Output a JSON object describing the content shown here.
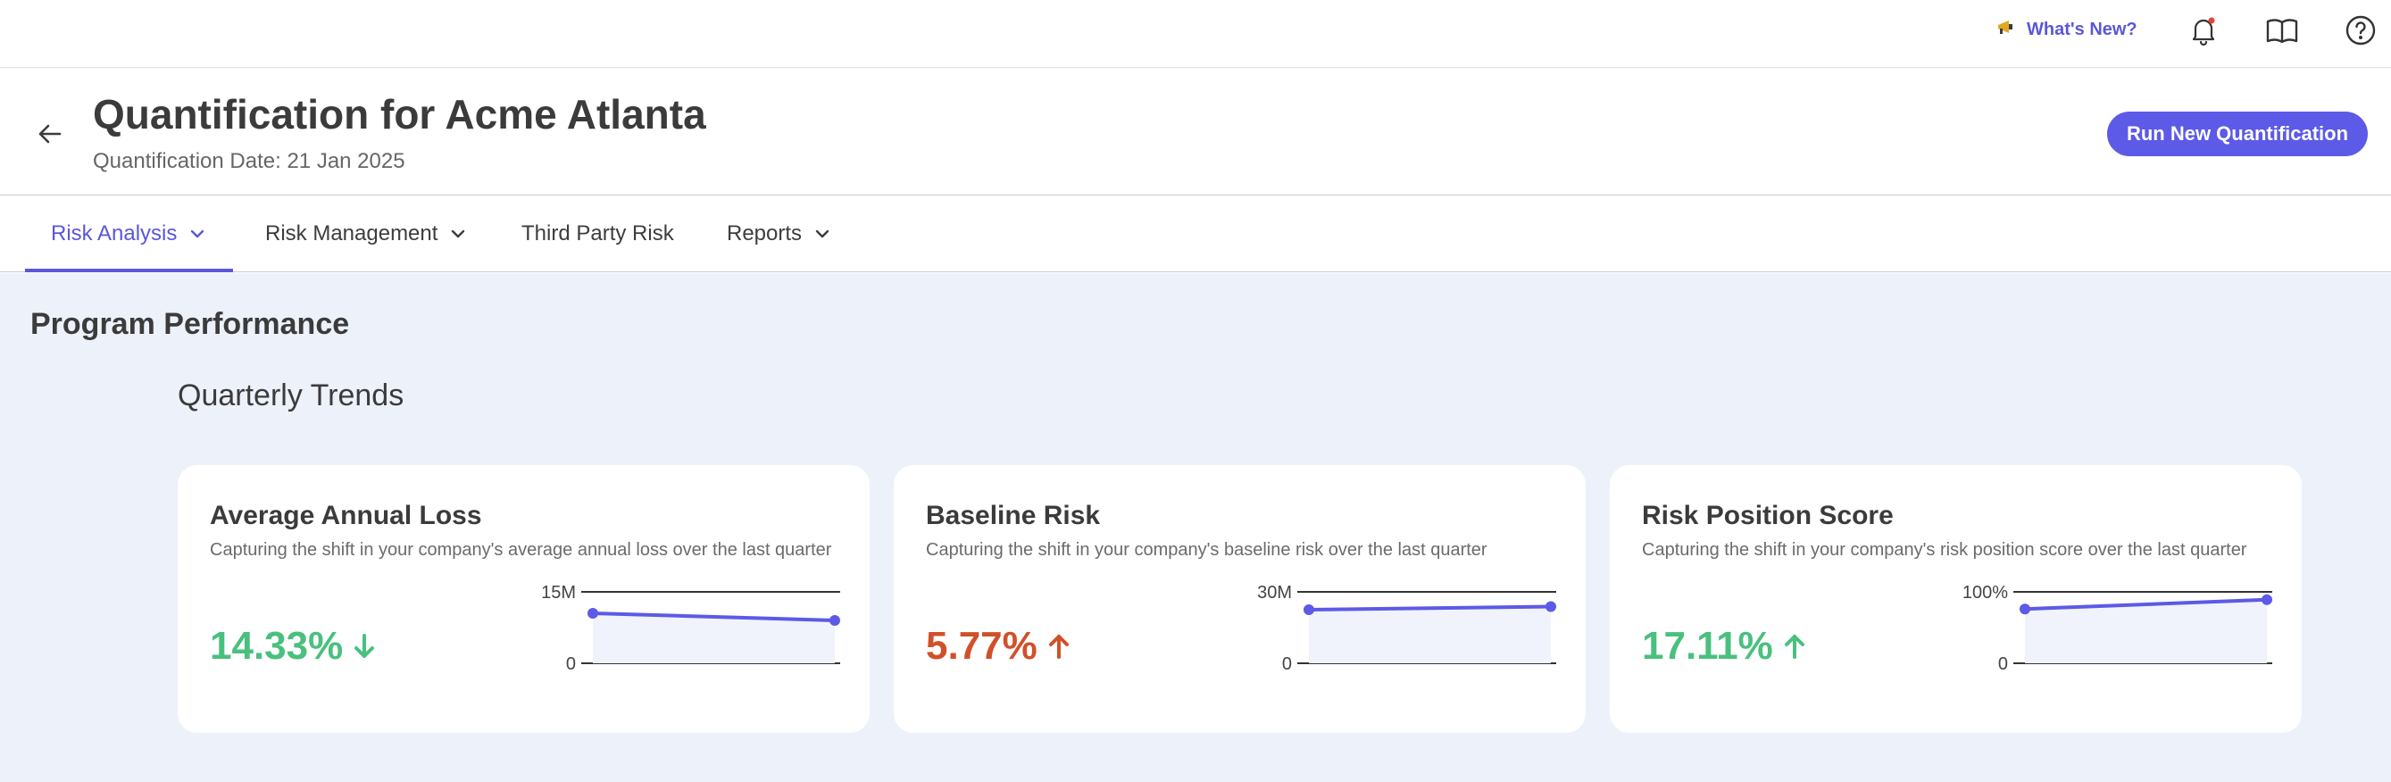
{
  "topbar": {
    "whats_new_label": "What's New?",
    "icons": [
      "notification-bell-icon",
      "book-icon",
      "help-icon"
    ]
  },
  "header": {
    "title": "Quantification for Acme Atlanta",
    "subtitle": "Quantification Date: 21 Jan 2025",
    "run_button": "Run New Quantification"
  },
  "tabs": [
    {
      "label": "Risk Analysis",
      "active": true,
      "has_dropdown": true
    },
    {
      "label": "Risk Management",
      "active": false,
      "has_dropdown": true
    },
    {
      "label": "Third Party Risk",
      "active": false,
      "has_dropdown": false
    },
    {
      "label": "Reports",
      "active": false,
      "has_dropdown": true
    }
  ],
  "main": {
    "section_title": "Program Performance",
    "subsection_title": "Quarterly Trends",
    "cards": [
      {
        "title": "Average Annual Loss",
        "description": "Capturing the shift in your company's average annual loss over the last quarter",
        "change": "14.33%",
        "direction": "down",
        "color": "#49c07e"
      },
      {
        "title": "Baseline Risk",
        "description": "Capturing the shift in your company's baseline risk over the last quarter",
        "change": "5.77%",
        "direction": "up",
        "color": "#d1502a"
      },
      {
        "title": "Risk Position Score",
        "description": "Capturing the shift in your company's risk position score over the last quarter",
        "change": "17.11%",
        "direction": "up",
        "color": "#49c07e"
      }
    ]
  },
  "colors": {
    "accent": "#5c5ae6",
    "positive": "#49c07e",
    "negative": "#d1502a",
    "background": "#edf1fa"
  },
  "chart_data": [
    {
      "type": "line",
      "y_ticks": [
        "15M",
        "0"
      ],
      "ylim": [
        0,
        15000000
      ],
      "values": [
        10500000,
        9000000
      ]
    },
    {
      "type": "line",
      "y_ticks": [
        "30M",
        "0"
      ],
      "ylim": [
        0,
        30000000
      ],
      "values": [
        22500000,
        23800000
      ]
    },
    {
      "type": "line",
      "y_ticks": [
        "100%",
        "0"
      ],
      "ylim": [
        0,
        100
      ],
      "values": [
        76,
        89
      ]
    }
  ]
}
